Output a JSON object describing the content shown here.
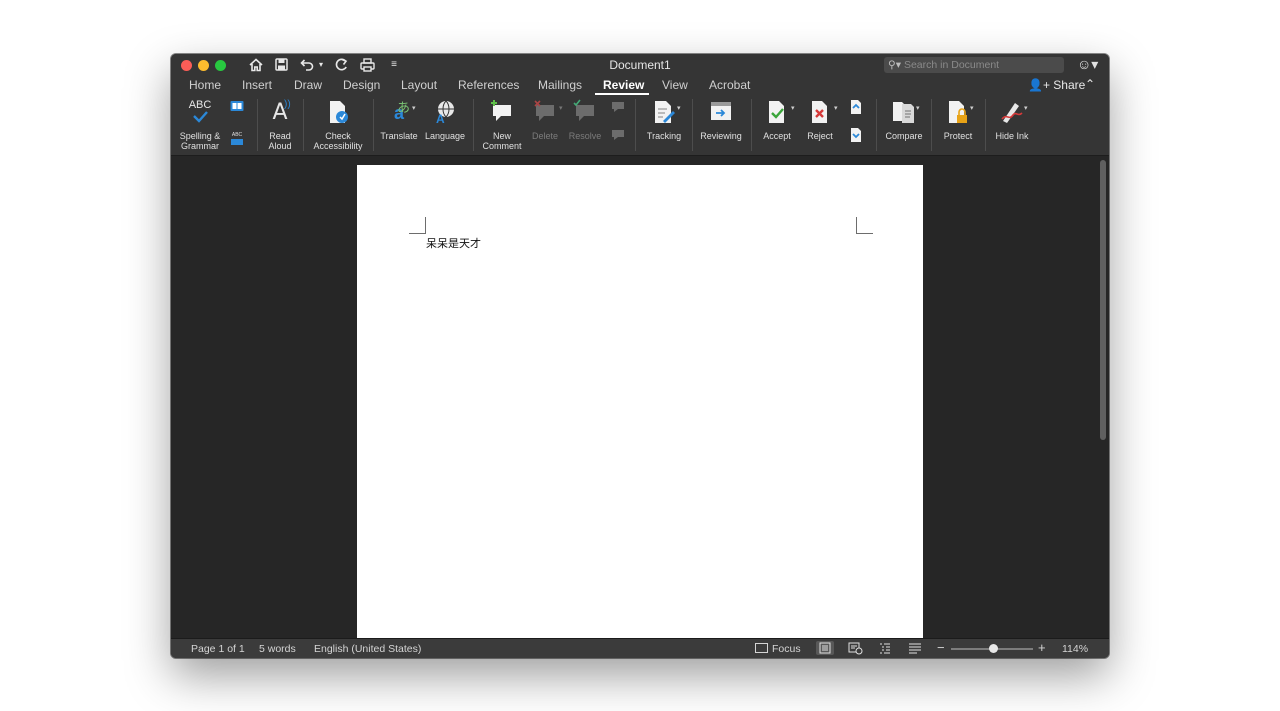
{
  "window": {
    "title": "Document1",
    "search_placeholder": "Search in Document"
  },
  "tabs": [
    {
      "label": "Home"
    },
    {
      "label": "Insert"
    },
    {
      "label": "Draw"
    },
    {
      "label": "Design"
    },
    {
      "label": "Layout"
    },
    {
      "label": "References"
    },
    {
      "label": "Mailings"
    },
    {
      "label": "Review",
      "active": true
    },
    {
      "label": "View"
    },
    {
      "label": "Acrobat"
    }
  ],
  "share_label": "Share",
  "ribbon": {
    "spelling": {
      "icon_text": "ABC",
      "label_1": "Spelling &",
      "label_2": "Grammar"
    },
    "word_count": {
      "icon_text": "ABC"
    },
    "read_aloud": {
      "label_1": "Read",
      "label_2": "Aloud"
    },
    "check_accessibility": {
      "label_1": "Check",
      "label_2": "Accessibility"
    },
    "translate": {
      "label": "Translate"
    },
    "language": {
      "label": "Language"
    },
    "new_comment": {
      "label_1": "New",
      "label_2": "Comment"
    },
    "delete": {
      "label": "Delete"
    },
    "resolve": {
      "label": "Resolve"
    },
    "tracking": {
      "label": "Tracking"
    },
    "reviewing": {
      "label": "Reviewing"
    },
    "accept": {
      "label": "Accept"
    },
    "reject": {
      "label": "Reject"
    },
    "compare": {
      "label": "Compare"
    },
    "protect": {
      "label": "Protect"
    },
    "hide_ink": {
      "label": "Hide Ink"
    }
  },
  "document": {
    "body_text": "呆呆是天才"
  },
  "statusbar": {
    "page": "Page 1 of 1",
    "words": "5 words",
    "language": "English (United States)",
    "focus": "Focus",
    "zoom": "114%",
    "zoom_percent": 114
  },
  "colors": {
    "window_bg": "#252525",
    "chrome_bg": "#353535",
    "accent_blue": "#2b88d8",
    "page": "#ffffff"
  }
}
